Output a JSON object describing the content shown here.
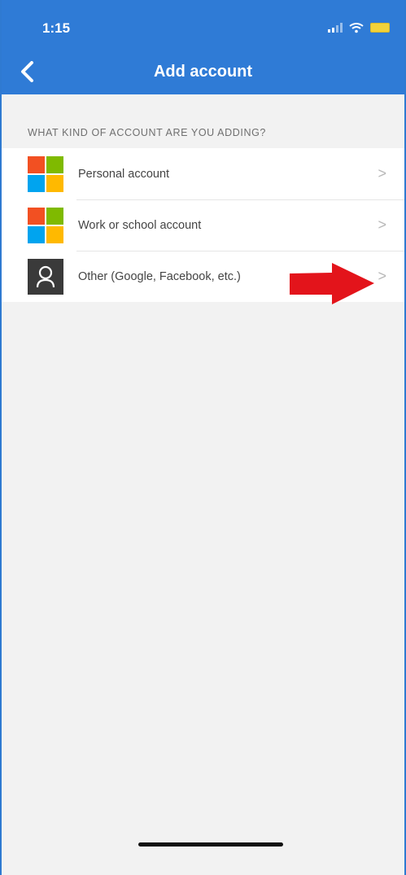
{
  "status_bar": {
    "time": "1:15",
    "icons": [
      "signal-icon",
      "wifi-icon",
      "battery-icon"
    ]
  },
  "nav": {
    "title": "Add account",
    "back_icon": "chevron-left-icon"
  },
  "section": {
    "header": "WHAT KIND OF ACCOUNT ARE YOU ADDING?"
  },
  "accounts": [
    {
      "label": "Personal account",
      "icon": "microsoft-logo-icon"
    },
    {
      "label": "Work or school account",
      "icon": "microsoft-logo-icon"
    },
    {
      "label": "Other (Google, Facebook, etc.)",
      "icon": "person-icon"
    }
  ],
  "chevron_glyph": ">",
  "colors": {
    "header_blue": "#2f7bd6",
    "background": "#f2f2f2",
    "arrow_red": "#e3141b",
    "ms_red": "#f25022",
    "ms_green": "#7fba00",
    "ms_blue": "#00a4ef",
    "ms_yellow": "#ffb900"
  }
}
